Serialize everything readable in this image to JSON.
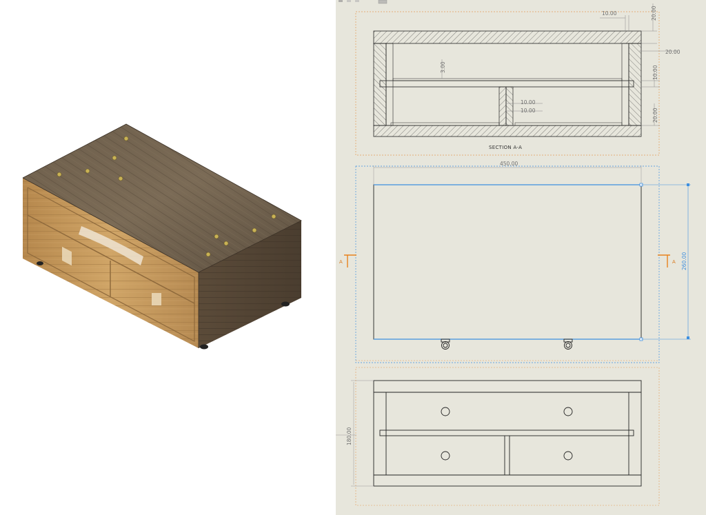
{
  "model_view": {
    "name": "wooden drawer cabinet isometric render"
  },
  "drawing": {
    "section_view": {
      "caption": "SECTION A-A",
      "dims": {
        "top_width": "10.00",
        "top_thickness": "20.00",
        "side_thickness": "20.00",
        "shelf_gap": "3.00",
        "shelf_thickness": "10.00",
        "divider_a": "10.00",
        "divider_b": "10.00",
        "bottom_thickness": "20.00"
      }
    },
    "top_view": {
      "width_dim": "450.00",
      "depth_dim": "260.00",
      "section_label_left": "A",
      "section_label_right": "A"
    },
    "front_view": {
      "height_dim": "180.00"
    },
    "colors": {
      "sheet_background": "#e7e6dc",
      "line": "#222222",
      "selection_blue": "#3d8fe0",
      "view_border_orange": "#e39a55",
      "section_arrow": "#e8821c"
    }
  }
}
